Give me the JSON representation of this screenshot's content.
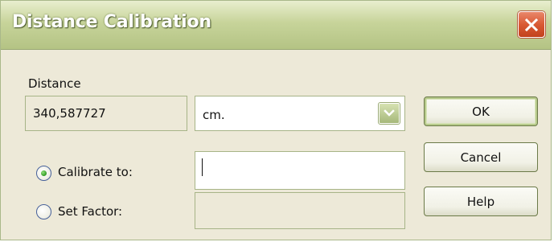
{
  "window": {
    "title": "Distance Calibration"
  },
  "icons": {
    "close": "close-icon",
    "dropdown": "chevron-down-icon"
  },
  "distance": {
    "label": "Distance",
    "value": "340,587727",
    "unit_selected": "cm."
  },
  "options": {
    "calibrate_label": "Calibrate to:",
    "calibrate_value": "",
    "calibrate_selected": true,
    "factor_label": "Set Factor:",
    "factor_value": "",
    "factor_selected": false
  },
  "buttons": {
    "ok": "OK",
    "cancel": "Cancel",
    "help": "Help"
  },
  "colors": {
    "titlebar": "#c7d49a",
    "dialog_bg": "#ede9d8",
    "close_red": "#d95a34",
    "radio_green": "#2f9a22"
  }
}
